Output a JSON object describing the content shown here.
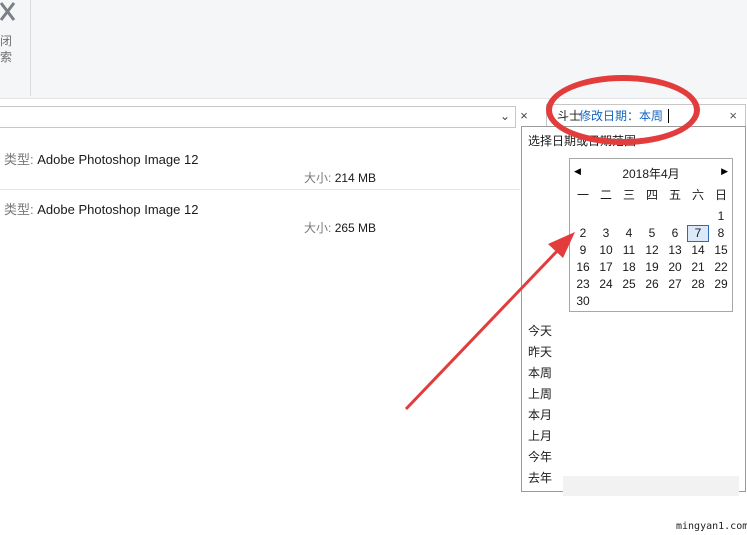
{
  "ribbon": {
    "close_search_label_1": "闭",
    "close_search_label_2": "索"
  },
  "search": {
    "prefix": "斗士",
    "filter_text": "修改日期：本周",
    "clear_label": "×"
  },
  "address_bar": {
    "chevron": "⌄",
    "close": "×"
  },
  "files": [
    {
      "type_label": "类型:",
      "type_value": "Adobe Photoshop Image 12",
      "size_label": "大小:",
      "size_value": "214 MB"
    },
    {
      "type_label": "类型:",
      "type_value": "Adobe Photoshop Image 12",
      "size_label": "大小:",
      "size_value": "265 MB"
    }
  ],
  "dropdown": {
    "hint": "选择日期或日期范围",
    "calendar": {
      "title": "2018年4月",
      "prev": "◀",
      "next": "▶",
      "weekdays": [
        "一",
        "二",
        "三",
        "四",
        "五",
        "六",
        "日"
      ],
      "today": "7",
      "days": [
        "1",
        "2",
        "3",
        "4",
        "5",
        "6",
        "7",
        "8",
        "9",
        "10",
        "11",
        "12",
        "13",
        "14",
        "15",
        "16",
        "17",
        "18",
        "19",
        "20",
        "21",
        "22",
        "23",
        "24",
        "25",
        "26",
        "27",
        "28",
        "29",
        "30"
      ]
    },
    "quick_ranges": [
      "今天",
      "昨天",
      "本周",
      "上周",
      "本月",
      "上月",
      "今年",
      "去年"
    ]
  },
  "watermark": "mingyan1.com",
  "colors": {
    "annotation": "#e23c3c",
    "link": "#1565c0",
    "today_border": "#2a6bbd"
  }
}
